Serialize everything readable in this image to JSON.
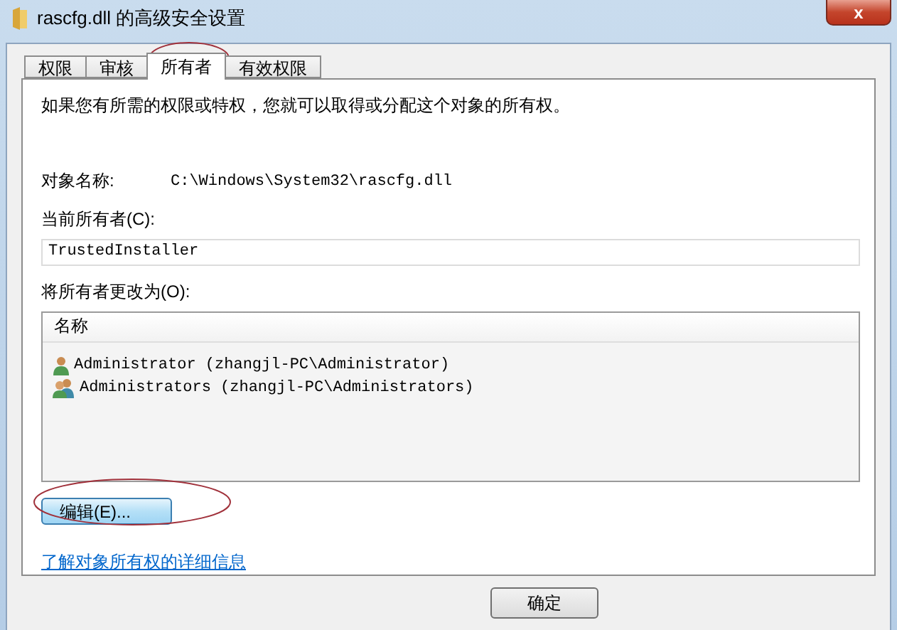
{
  "window": {
    "title": "rascfg.dll 的高级安全设置",
    "close": "x"
  },
  "tabs": [
    {
      "label": "权限",
      "selected": false,
      "circled": false
    },
    {
      "label": "审核",
      "selected": false,
      "circled": false
    },
    {
      "label": "所有者",
      "selected": true,
      "circled": true
    },
    {
      "label": "有效权限",
      "selected": false,
      "circled": false
    }
  ],
  "intro": "如果您有所需的权限或特权，您就可以取得或分配这个对象的所有权。",
  "object_name": {
    "label": "对象名称:",
    "value": "C:\\Windows\\System32\\rascfg.dll"
  },
  "current_owner": {
    "label": "当前所有者(C):",
    "value": "TrustedInstaller"
  },
  "change_owner": {
    "label": "将所有者更改为(O):",
    "column": "名称",
    "rows": [
      {
        "kind": "user",
        "name": "Administrator (zhangjl-PC\\Administrator)"
      },
      {
        "kind": "group",
        "name": "Administrators (zhangjl-PC\\Administrators)"
      }
    ]
  },
  "edit_button": {
    "label": "编辑(E)...",
    "circled": true
  },
  "link": "了解对象所有权的详细信息",
  "buttons": [
    "确定"
  ]
}
